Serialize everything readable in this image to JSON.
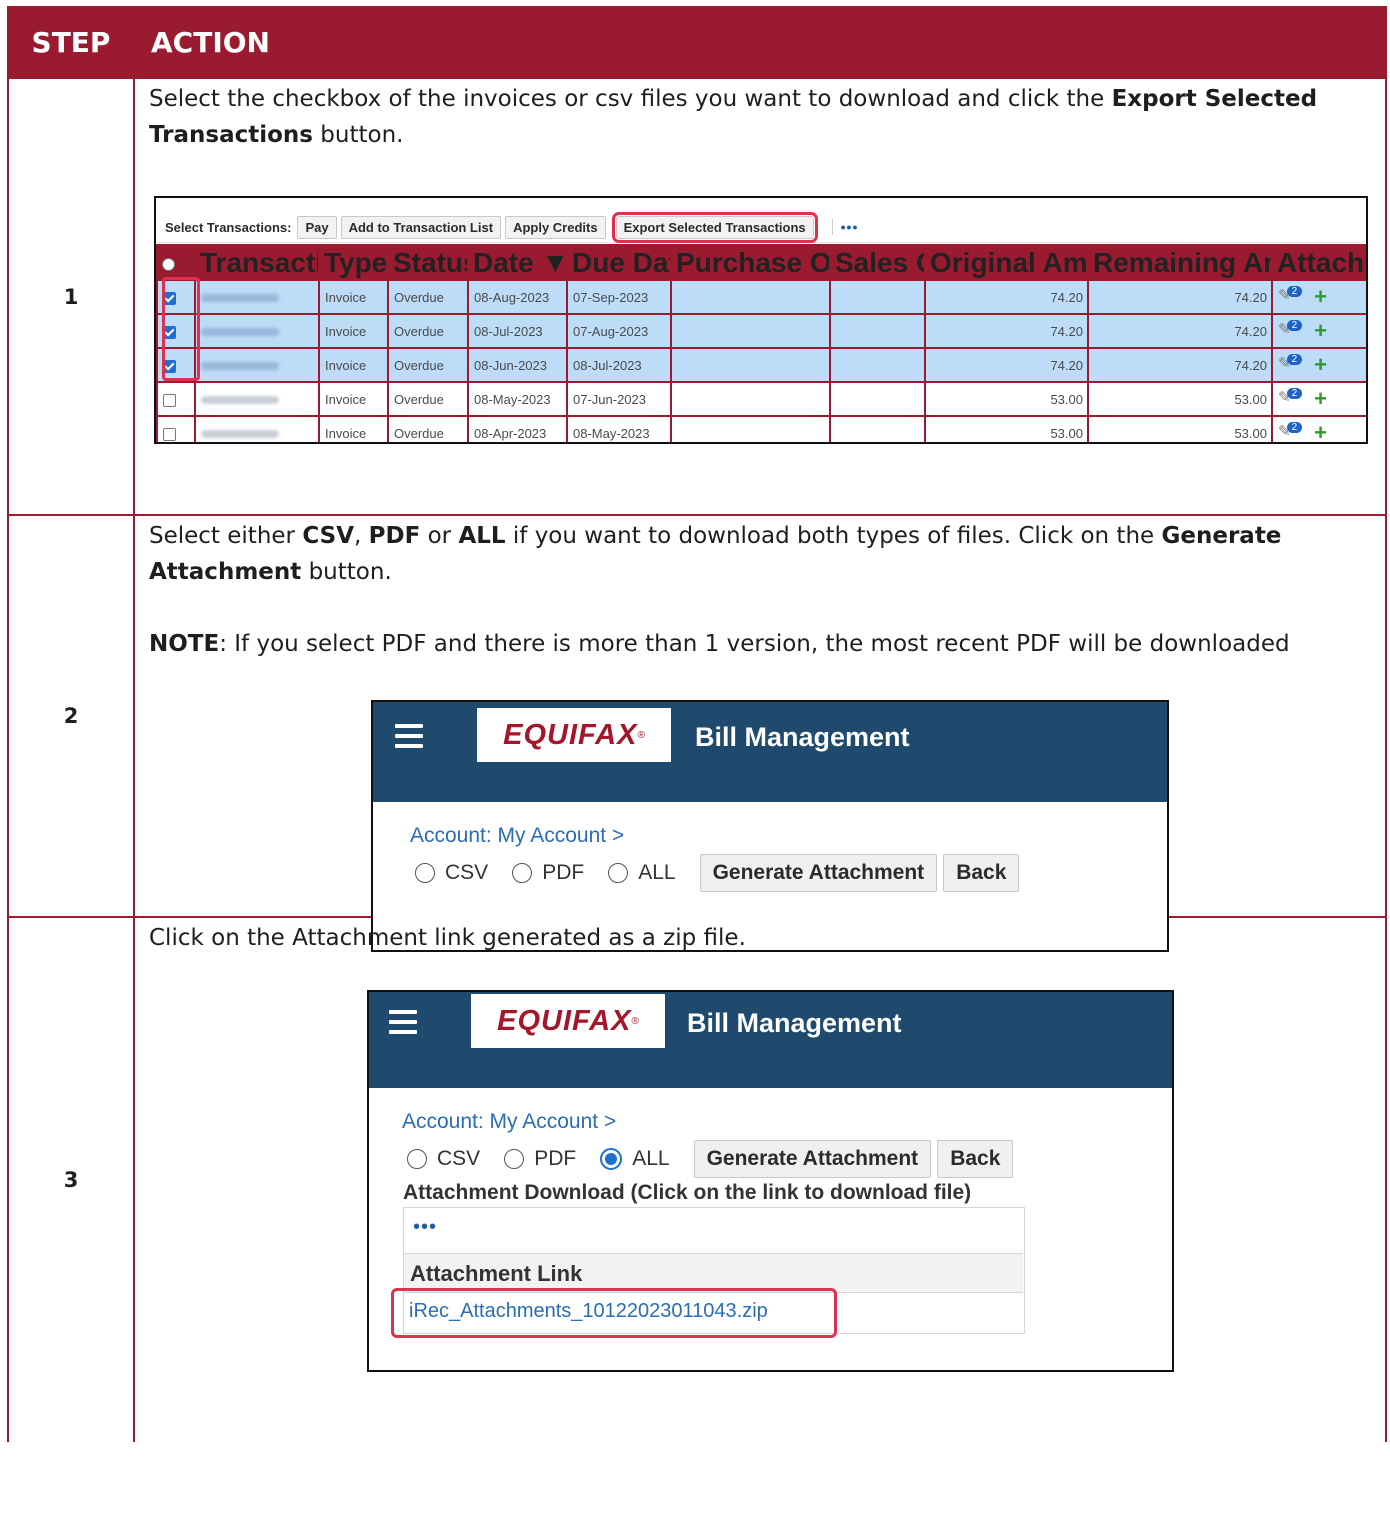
{
  "table": {
    "header_step": "STEP",
    "header_action": "ACTION"
  },
  "steps": [
    {
      "number": "1",
      "text_1": "Select the checkbox of the invoices or csv files you want to download and click the ",
      "bold_1": "Export Selected Transactions",
      "text_2": " button."
    },
    {
      "number": "2",
      "text_1": "Select either ",
      "bold_csv": "CSV",
      "sep_1": ", ",
      "bold_pdf": "PDF",
      "sep_2": " or ",
      "bold_all": "ALL",
      "text_2": " if you want to download both types of files. Click on the ",
      "bold_generate": "Generate Attachment",
      "text_3": " button.",
      "note_label": "NOTE",
      "note_text": ": If you select PDF and there is more than 1 version, the most recent PDF will be downloaded"
    },
    {
      "number": "3",
      "text_1": "Click on the Attachment link generated as a zip file."
    }
  ],
  "shot1": {
    "toolbar_label": "Select Transactions:",
    "buttons": [
      "Pay",
      "Add to Transaction List",
      "Apply Credits",
      "Export Selected Transactions"
    ],
    "more": "•••",
    "columns": {
      "transaction": "Transaction △",
      "type": "Type △",
      "status": "Status △",
      "date": "Date ▼",
      "due_date": "Due Date △",
      "purchase_order": "Purchase Order △",
      "sales_order": "Sales Order",
      "original_amount": "Original Amount △",
      "remaining_amount": "Remaining Amount △",
      "attachments": "Attachments"
    },
    "rows": [
      {
        "type": "Invoice",
        "status": "Overdue",
        "date": "08-Aug-2023",
        "due_date": "07-Sep-2023",
        "original": "74.20",
        "remaining": "74.20",
        "badge": "2"
      },
      {
        "type": "Invoice",
        "status": "Overdue",
        "date": "08-Jul-2023",
        "due_date": "07-Aug-2023",
        "original": "74.20",
        "remaining": "74.20",
        "badge": "2"
      },
      {
        "type": "Invoice",
        "status": "Overdue",
        "date": "08-Jun-2023",
        "due_date": "08-Jul-2023",
        "original": "74.20",
        "remaining": "74.20",
        "badge": "2"
      },
      {
        "type": "Invoice",
        "status": "Overdue",
        "date": "08-May-2023",
        "due_date": "07-Jun-2023",
        "original": "53.00",
        "remaining": "53.00",
        "badge": "2"
      },
      {
        "type": "Invoice",
        "status": "Overdue",
        "date": "08-Apr-2023",
        "due_date": "08-May-2023",
        "original": "53.00",
        "remaining": "53.00",
        "badge": "2"
      }
    ]
  },
  "bill": {
    "logo": "EQUIFAX",
    "logo_mark": "®",
    "title": "Bill Management",
    "breadcrumb": "Account: My Account  >",
    "options": [
      "CSV",
      "PDF",
      "ALL"
    ],
    "generate_label": "Generate Attachment",
    "back_label": "Back",
    "download_title": "Attachment Download (Click on the link to download file)",
    "download_more": "•••",
    "link_header": "Attachment Link",
    "link_text": "iRec_Attachments_10122023011043.zip"
  },
  "colors": {
    "header_bg": "#9a1b30",
    "accent_red": "#e0304e",
    "brand_blue": "#1f4a6e",
    "selection": "#bcdcf8"
  }
}
